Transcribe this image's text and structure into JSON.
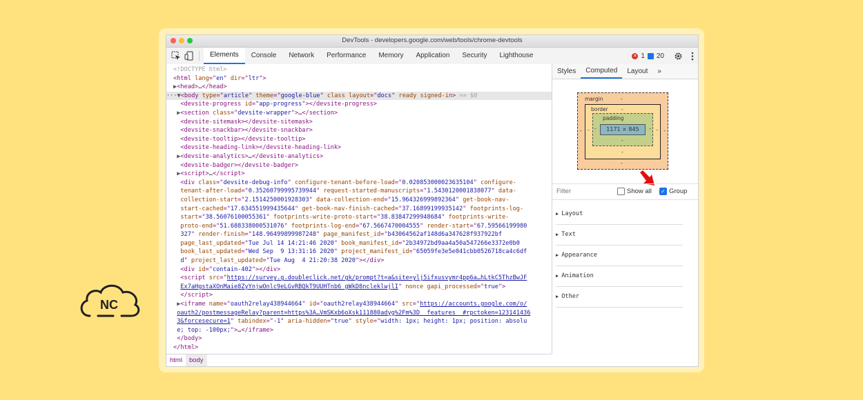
{
  "logo": {
    "text": "NC"
  },
  "window": {
    "title": "DevTools - developers.google.com/web/tools/chrome-devtools"
  },
  "toolbar": {
    "tabs": [
      "Elements",
      "Console",
      "Network",
      "Performance",
      "Memory",
      "Application",
      "Security",
      "Lighthouse"
    ],
    "active_tab": "Elements",
    "error_count": "1",
    "message_count": "20"
  },
  "dom_lines": [
    {
      "html": "<span class=\"c\">&lt;!DOCTYPE html&gt;</span>"
    },
    {
      "html": "<span class=\"t\">&lt;html </span><span class=\"a\">lang</span><span class=\"t\">=\"</span><span class=\"v\">en</span><span class=\"t\">\" </span><span class=\"a\">dir</span><span class=\"t\">=\"</span><span class=\"v\">ltr</span><span class=\"t\">\"&gt;</span>"
    },
    {
      "html": "<span class=\"tri\">▶</span><span class=\"t\">&lt;head&gt;</span><span class=\"tx\">…</span><span class=\"t\">&lt;/head&gt;</span>"
    },
    {
      "html": "<span class=\"tri\">···▼</span><span class=\"t\">&lt;body </span><span class=\"a\">type</span><span class=\"t\">=\"</span><span class=\"v\">article</span><span class=\"t\">\" </span><span class=\"a\">theme</span><span class=\"t\">=\"</span><span class=\"v\">google-blue</span><span class=\"t\">\" </span><span class=\"a\">class layout</span><span class=\"t\">=\"</span><span class=\"v\">docs</span><span class=\"t\">\" </span><span class=\"a\">ready signed-in</span><span class=\"t\">&gt;</span><span class=\"c\"> == $0</span>",
      "selected": true
    },
    {
      "html": "  <span class=\"t\">&lt;devsite-progress </span><span class=\"a\">id</span><span class=\"t\">=\"</span><span class=\"v\">app-progress</span><span class=\"t\">\"&gt;&lt;/devsite-progress&gt;</span>"
    },
    {
      "html": " <span class=\"tri\">▶</span><span class=\"t\">&lt;section </span><span class=\"a\">class</span><span class=\"t\">=\"</span><span class=\"v\">devsite-wrapper</span><span class=\"t\">\"&gt;</span><span class=\"tx\">…</span><span class=\"t\">&lt;/section&gt;</span>"
    },
    {
      "html": "  <span class=\"t\">&lt;devsite-sitemask&gt;&lt;/devsite-sitemask&gt;</span>"
    },
    {
      "html": "  <span class=\"t\">&lt;devsite-snackbar&gt;&lt;/devsite-snackbar&gt;</span>"
    },
    {
      "html": "  <span class=\"t\">&lt;devsite-tooltip&gt;&lt;/devsite-tooltip&gt;</span>"
    },
    {
      "html": "  <span class=\"t\">&lt;devsite-heading-link&gt;&lt;/devsite-heading-link&gt;</span>"
    },
    {
      "html": " <span class=\"tri\">▶</span><span class=\"t\">&lt;devsite-analytics&gt;</span><span class=\"tx\">…</span><span class=\"t\">&lt;/devsite-analytics&gt;</span>"
    },
    {
      "html": "  <span class=\"t\">&lt;devsite-badger&gt;&lt;/devsite-badger&gt;</span>"
    },
    {
      "html": " <span class=\"tri\">▶</span><span class=\"t\">&lt;script&gt;</span><span class=\"tx\">…</span><span class=\"t\">&lt;/script&gt;</span>"
    },
    {
      "html": "  <span class=\"t\">&lt;div </span><span class=\"a\">class</span><span class=\"t\">=\"</span><span class=\"v\">devsite-debug-info</span><span class=\"t\">\" </span><span class=\"a\">configure-tenant-before-load</span><span class=\"t\">=\"</span><span class=\"v\">0.020853000023635104</span><span class=\"t\">\" </span><span class=\"a\">configure-</span>"
    },
    {
      "html": "  <span class=\"a\">tenant-after-load</span><span class=\"t\">=\"</span><span class=\"v\">0.35260799995739944</span><span class=\"t\">\" </span><span class=\"a\">request-started-manuscripts</span><span class=\"t\">=\"</span><span class=\"v\">1.5430120001838077</span><span class=\"t\">\" </span><span class=\"a\">data-</span>"
    },
    {
      "html": "  <span class=\"a\">collection-start</span><span class=\"t\">=\"</span><span class=\"v\">2.1514250001928303</span><span class=\"t\">\" </span><span class=\"a\">data-collection-end</span><span class=\"t\">=\"</span><span class=\"v\">15.964326999892364</span><span class=\"t\">\" </span><span class=\"a\">get-book-nav-</span>"
    },
    {
      "html": "  <span class=\"a\">start-cached</span><span class=\"t\">=\"</span><span class=\"v\">17.634551999435644</span><span class=\"t\">\" </span><span class=\"a\">get-book-nav-finish-cached</span><span class=\"t\">=\"</span><span class=\"v\">37.16899199935142</span><span class=\"t\">\" </span><span class=\"a\">footprints-log-</span>"
    },
    {
      "html": "  <span class=\"a\">start</span><span class=\"t\">=\"</span><span class=\"v\">38.56076100055361</span><span class=\"t\">\" </span><span class=\"a\">footprints-write-proto-start</span><span class=\"t\">=\"</span><span class=\"v\">38.83847299948684</span><span class=\"t\">\" </span><span class=\"a\">footprints-write-</span>"
    },
    {
      "html": "  <span class=\"a\">proto-end</span><span class=\"t\">=\"</span><span class=\"v\">51.688338000531076</span><span class=\"t\">\" </span><span class=\"a\">footprints-log-end</span><span class=\"t\">=\"</span><span class=\"v\">67.5667470004555</span><span class=\"t\">\" </span><span class=\"a\">render-start</span><span class=\"t\">=\"</span><span class=\"v\">67.59566199980</span>"
    },
    {
      "html": "  <span class=\"v\">327</span><span class=\"t\">\" </span><span class=\"a\">render-finish</span><span class=\"t\">=\"</span><span class=\"v\">148.96499899987248</span><span class=\"t\">\" </span><span class=\"a\">page_manifest_id</span><span class=\"t\">=\"</span><span class=\"v\">b43064562af148d6a347628f937922bf</span>"
    },
    {
      "html": "  <span class=\"a\">page_last_updated</span><span class=\"t\">=\"</span><span class=\"v\">Tue Jul 14 14:21:46 2020</span><span class=\"t\">\" </span><span class=\"a\">book_manifest_id</span><span class=\"t\">=\"</span><span class=\"v\">2b34972bd9aa4a50a547266e3372e0b0</span>"
    },
    {
      "html": "  <span class=\"a\">book_last_updated</span><span class=\"t\">=\"</span><span class=\"v\">Wed Sep  9 13:31:16 2020</span><span class=\"t\">\" </span><span class=\"a\">project_manifest_id</span><span class=\"t\">=\"</span><span class=\"v\">65059fe3e5e041cbb0526718ca4c6df</span>"
    },
    {
      "html": "  <span class=\"v\">d</span><span class=\"t\">\" </span><span class=\"a\">project_last_updated</span><span class=\"t\">=\"</span><span class=\"v\">Tue Aug  4 21:20:38 2020</span><span class=\"t\">\"&gt;&lt;/div&gt;</span>"
    },
    {
      "html": "  <span class=\"t\">&lt;div </span><span class=\"a\">id</span><span class=\"t\">=\"</span><span class=\"v\">contain-402</span><span class=\"t\">\"&gt;&lt;/div&gt;</span>"
    },
    {
      "html": "  <span class=\"t\">&lt;script </span><span class=\"a\">src</span><span class=\"t\">=\"</span><span class=\"u\">https://survey.g.doubleclick.net/gk/prompt?t=a&amp;site=ylj5ifxusvymr4pp6a…hLtkC5ThzBwJF</span>"
    },
    {
      "html": "  <span class=\"u\">Ex7aHgstaXOnMaie8ZyYnjwOnlc9eLGvRBQkT9UUHTnb6_gWkD8ncleklwjlI</span><span class=\"t\">\" </span><span class=\"a\">nonce gapi_processed</span><span class=\"t\">=\"</span><span class=\"v\">true</span><span class=\"t\">\"&gt;</span>"
    },
    {
      "html": "  <span class=\"t\">&lt;/script&gt;</span>"
    },
    {
      "html": " <span class=\"tri\">▶</span><span class=\"t\">&lt;iframe </span><span class=\"a\">name</span><span class=\"t\">=\"</span><span class=\"v\">oauth2relay438944664</span><span class=\"t\">\" </span><span class=\"a\">id</span><span class=\"t\">=\"</span><span class=\"v\">oauth2relay438944664</span><span class=\"t\">\" </span><span class=\"a\">src</span><span class=\"t\">=\"</span><span class=\"u\">https://accounts.google.com/o/</span>"
    },
    {
      "html": " <span class=\"u\">oauth2/postmessageRelay?parent=https%3A…VmSKxb6oXsk111880adyg%2Fm%3D__features__#rpctoken=123141436</span>"
    },
    {
      "html": " <span class=\"u\">3&amp;forcesecure=1</span><span class=\"t\">\" </span><span class=\"a\">tabindex</span><span class=\"t\">=\"</span><span class=\"v\">-1</span><span class=\"t\">\" </span><span class=\"a\">aria-hidden</span><span class=\"t\">=\"</span><span class=\"v\">true</span><span class=\"t\">\" </span><span class=\"a\">style</span><span class=\"t\">=\"</span><span class=\"v\">width: 1px; height: 1px; position: absolu</span>"
    },
    {
      "html": " <span class=\"v\">e; top: -100px;</span><span class=\"t\">\"&gt;</span><span class=\"tx\">…</span><span class=\"t\">&lt;/iframe&gt;</span>"
    },
    {
      "html": " <span class=\"t\">&lt;/body&gt;</span>"
    },
    {
      "html": "<span class=\"t\">&lt;/html&gt;</span>"
    }
  ],
  "breadcrumbs": [
    "html",
    "body"
  ],
  "sidebar": {
    "tabs": [
      "Styles",
      "Computed",
      "Layout",
      "»"
    ],
    "active_tab": "Computed",
    "box_model": {
      "margin_label": "margin",
      "border_label": "border",
      "padding_label": "padding",
      "content_size": "1171 × 845",
      "dash": "-"
    },
    "filter_placeholder": "Filter",
    "show_all_label": "Show all",
    "show_all_checked": false,
    "group_label": "Group",
    "group_checked": true,
    "groups": [
      "Layout",
      "Text",
      "Appearance",
      "Animation",
      "Other"
    ]
  }
}
